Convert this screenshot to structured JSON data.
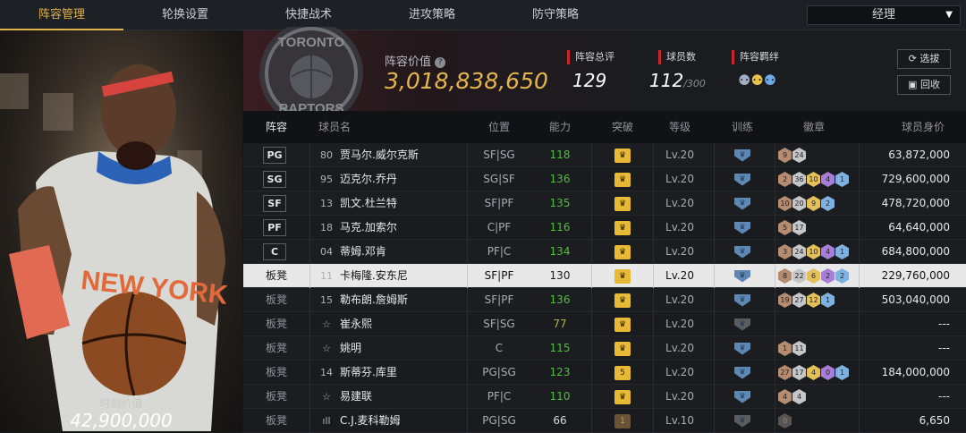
{
  "nav": {
    "tabs": [
      "阵容管理",
      "轮换设置",
      "快捷战术",
      "进攻策略",
      "防守策略"
    ],
    "active_index": 0,
    "manager_label": "经理"
  },
  "featured_player": {
    "jersey_text": "NEW YORK",
    "moment_value_label": "时刻价值",
    "moment_value": "42,900,000"
  },
  "team": {
    "logo_text_top": "TORONTO",
    "logo_text_bottom": "RAPTORS",
    "value_label": "阵容价值",
    "value": "3,018,838,650"
  },
  "stats": {
    "overall_label": "阵容总评",
    "overall_value": "129",
    "count_label": "球员数",
    "count_value": "112",
    "count_max": "/300",
    "chem_label": "阵容羁绊"
  },
  "buttons": {
    "select_label": "选拔",
    "recycle_label": "回收"
  },
  "table": {
    "headers": [
      "阵容",
      "球员名",
      "位置",
      "能力",
      "突破",
      "等级",
      "训练",
      "徽章",
      "球员身价"
    ],
    "rows": [
      {
        "slot": "PG",
        "num": "80",
        "name": "贾马尔.威尔克斯",
        "position": "SF|SG",
        "ability": "118",
        "ability_color": "green",
        "breakthrough": "",
        "level": "Lv.20",
        "badges": [
          [
            "9",
            "bronze"
          ],
          [
            "24",
            "silver"
          ]
        ],
        "salary": "63,872,000"
      },
      {
        "slot": "SG",
        "num": "95",
        "name": "迈克尔.乔丹",
        "position": "SG|SF",
        "ability": "136",
        "ability_color": "green",
        "breakthrough": "",
        "level": "Lv.20",
        "badges": [
          [
            "2",
            "bronze"
          ],
          [
            "36",
            "silver"
          ],
          [
            "10",
            "gold"
          ],
          [
            "4",
            "purple"
          ],
          [
            "1",
            "blue"
          ]
        ],
        "salary": "729,600,000"
      },
      {
        "slot": "SF",
        "num": "13",
        "name": "凯文.杜兰特",
        "position": "SF|PF",
        "ability": "135",
        "ability_color": "green",
        "breakthrough": "",
        "level": "Lv.20",
        "badges": [
          [
            "10",
            "bronze"
          ],
          [
            "20",
            "silver"
          ],
          [
            "9",
            "gold"
          ],
          [
            "2",
            "blue"
          ]
        ],
        "salary": "478,720,000"
      },
      {
        "slot": "PF",
        "num": "18",
        "name": "马克.加索尔",
        "position": "C|PF",
        "ability": "116",
        "ability_color": "green",
        "breakthrough": "",
        "level": "Lv.20",
        "badges": [
          [
            "5",
            "bronze"
          ],
          [
            "17",
            "silver"
          ]
        ],
        "salary": "64,640,000"
      },
      {
        "slot": "C",
        "num": "04",
        "name": "蒂姆.邓肯",
        "position": "PF|C",
        "ability": "134",
        "ability_color": "green",
        "breakthrough": "",
        "level": "Lv.20",
        "badges": [
          [
            "3",
            "bronze"
          ],
          [
            "24",
            "silver"
          ],
          [
            "10",
            "gold"
          ],
          [
            "4",
            "purple"
          ],
          [
            "1",
            "blue"
          ]
        ],
        "salary": "684,800,000"
      },
      {
        "slot": "板凳",
        "num": "11",
        "name": "卡梅隆.安东尼",
        "position": "SF|PF",
        "ability": "130",
        "ability_color": "dark",
        "breakthrough": "",
        "level": "Lv.20",
        "badges": [
          [
            "8",
            "bronze"
          ],
          [
            "22",
            "silver"
          ],
          [
            "6",
            "gold"
          ],
          [
            "2",
            "purple"
          ],
          [
            "2",
            "blue"
          ]
        ],
        "salary": "229,760,000",
        "selected": true
      },
      {
        "slot": "板凳",
        "num": "15",
        "name": "勒布朗.詹姆斯",
        "position": "SF|PF",
        "ability": "136",
        "ability_color": "green",
        "breakthrough": "",
        "level": "Lv.20",
        "badges": [
          [
            "19",
            "bronze"
          ],
          [
            "27",
            "silver"
          ],
          [
            "12",
            "gold"
          ],
          [
            "1",
            "blue"
          ]
        ],
        "salary": "503,040,000"
      },
      {
        "slot": "板凳",
        "num": "☆",
        "name": "崔永熙",
        "position": "SF|SG",
        "ability": "77",
        "ability_color": "olive",
        "breakthrough": "",
        "level": "Lv.20",
        "badges": [],
        "salary": "---",
        "training_dark": true
      },
      {
        "slot": "板凳",
        "num": "☆",
        "name": "姚明",
        "position": "C",
        "ability": "115",
        "ability_color": "green",
        "breakthrough": "",
        "level": "Lv.20",
        "badges": [
          [
            "1",
            "bronze"
          ],
          [
            "11",
            "silver"
          ]
        ],
        "salary": "---"
      },
      {
        "slot": "板凳",
        "num": "14",
        "name": "斯蒂芬.库里",
        "position": "PG|SG",
        "ability": "123",
        "ability_color": "green",
        "breakthrough": "5",
        "level": "Lv.20",
        "badges": [
          [
            "27",
            "bronze"
          ],
          [
            "17",
            "silver"
          ],
          [
            "4",
            "gold"
          ],
          [
            "0",
            "purple"
          ],
          [
            "1",
            "blue"
          ]
        ],
        "salary": "184,000,000"
      },
      {
        "slot": "板凳",
        "num": "☆",
        "name": "易建联",
        "position": "PF|C",
        "ability": "110",
        "ability_color": "green",
        "breakthrough": "",
        "level": "Lv.20",
        "badges": [
          [
            "4",
            "bronze"
          ],
          [
            "4",
            "silver"
          ]
        ],
        "salary": "---"
      },
      {
        "slot": "板凳",
        "num": "ıll",
        "name": "C.J.麦科勒姆",
        "position": "PG|SG",
        "ability": "66",
        "ability_color": "white",
        "breakthrough": "1",
        "breakthrough_dark": true,
        "level": "Lv.10",
        "badges": [
          [
            "0",
            "dark"
          ]
        ],
        "salary": "6,650",
        "training_dark": true
      }
    ]
  }
}
